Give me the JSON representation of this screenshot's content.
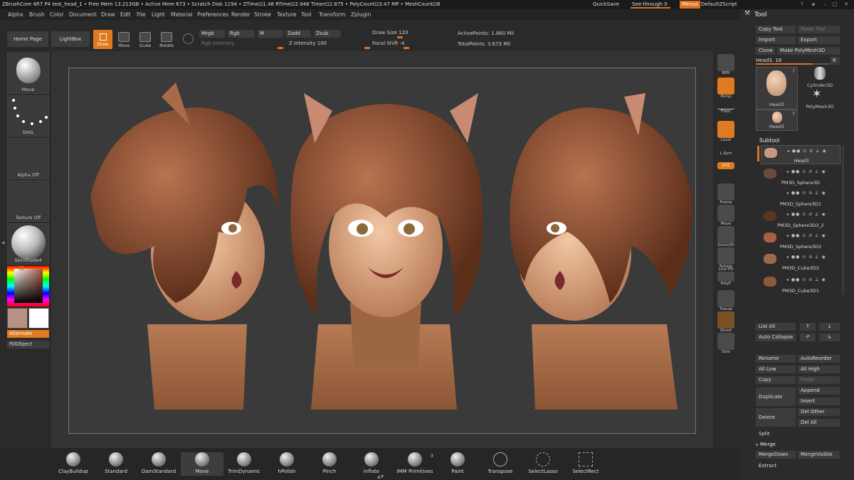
{
  "titlebar": {
    "title": "ZBrushCore 4R7 P4   test_head_1   • Free Mem 13.213GB • Active Mem 673 • Scratch Disk 1194 • ZTime⊡1.48 RTime⊡2.948 Timer⊡2.875 • PolyCount⊡3.47 MP • MeshCount⊡6",
    "quicksave": "QuickSave",
    "see_through": "See-through  0",
    "menus": "Menus",
    "default_script": "DefaultZScript"
  },
  "menubar": [
    "Alpha",
    "Brush",
    "Color",
    "Document",
    "Draw",
    "Edit",
    "File",
    "Light",
    "Material",
    "Preferences",
    "Render",
    "Stroke",
    "Texture",
    "Tool",
    "Transform",
    "Zplugin"
  ],
  "shelf": {
    "home_page": "Home Page",
    "lightbox": "LightBox",
    "draw": "Draw",
    "move": "Move",
    "scale": "Scale",
    "rotate": "Rotate",
    "mrgb": "Mrgb",
    "rgb": "Rgb",
    "m": "M",
    "zadd": "Zadd",
    "zsub": "Zsub",
    "rgb_intensity": "Rgb Intensity",
    "z_intensity_label": "Z Intensity",
    "z_intensity_value": "100",
    "draw_size_label": "Draw Size",
    "draw_size_value": "120",
    "focal_shift_label": "Focal Shift",
    "focal_shift_value": "-4",
    "active_points": "ActivePoints: 1.660 Mil",
    "total_points": "TotalPoints: 3.673 Mil"
  },
  "leftpanel": {
    "move": "Move",
    "dots": "Dots",
    "alpha_off": "Alpha Off",
    "texture_off": "Texture Off",
    "material": "SkinShade4",
    "alternate": "Alternate",
    "fill_object": "FillObject"
  },
  "righttools": [
    "BPR",
    "Persp",
    "Floor",
    "Local",
    "L.Sym",
    "XYZ",
    "Frame",
    "Move",
    "Zoom3D",
    "Rotate",
    "Line Fill",
    "PolyF",
    "Transp",
    "Ghost",
    "Solo"
  ],
  "bottom": [
    "ClayBuildup",
    "Standard",
    "DamStandard",
    "Move",
    "TrimDynamic",
    "hPolish",
    "Pinch",
    "Inflate",
    "IMM Primitives",
    "Paint",
    "Transpose",
    "SelectLasso",
    "SelectRect"
  ],
  "imm_count": "3",
  "tool": {
    "title": "Tool",
    "copy_tool": "Copy Tool",
    "paste_tool": "Paste Tool",
    "import": "Import",
    "export": "Export",
    "clone": "Clone",
    "make_polymesh": "Make PolyMesh3D",
    "head_label": "Head3.",
    "head_value": "16",
    "r": "R",
    "thumb_head": "Head3",
    "thumb_cylinder": "Cylinder3D",
    "thumb_polymesh": "PolyMesh3D",
    "thumb_head_small": "Head3",
    "thumb_count": "7",
    "thumb_count2": "7",
    "subtool": "Subtool",
    "subtools": [
      "Head3",
      "PM3D_Sphere3D",
      "PM3D_Sphere3D1",
      "PM3D_Sphere3D3_2",
      "PM3D_Sphere3D3",
      "PM3D_Cube3D2",
      "PM3D_Cube3D1"
    ],
    "list_all": "List All",
    "auto_collapse": "Auto Collapse",
    "rename": "Rename",
    "auto_reorder": "AutoReorder",
    "all_low": "All Low",
    "all_high": "All High",
    "copy": "Copy",
    "paste": "Paste",
    "duplicate": "Duplicate",
    "append": "Append",
    "insert": "Insert",
    "delete": "Delete",
    "del_other": "Del Other",
    "del_all": "Del All",
    "split": "Split",
    "merge": "Merge",
    "merge_down": "MergeDown",
    "merge_visible": "MergeVisible",
    "extract": "Extract"
  }
}
